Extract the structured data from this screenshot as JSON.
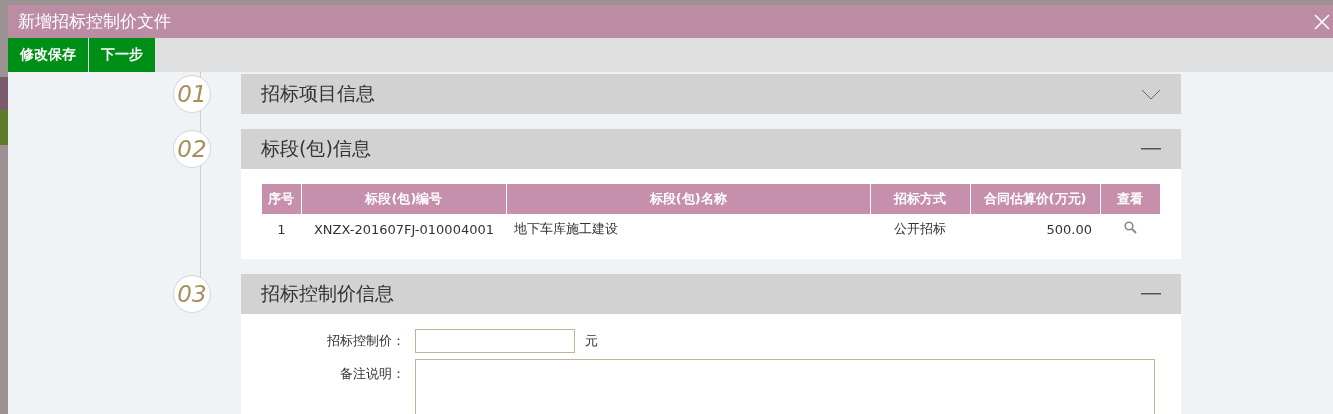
{
  "dialog": {
    "title": "新增招标控制价文件"
  },
  "toolbar": {
    "buttons": [
      "修改保存",
      "下一步"
    ]
  },
  "sections": [
    {
      "number": "01",
      "title": "招标项目信息",
      "expanded": false
    },
    {
      "number": "02",
      "title": "标段(包)信息",
      "expanded": true,
      "kind": "table"
    },
    {
      "number": "03",
      "title": "招标控制价信息",
      "expanded": true,
      "kind": "form"
    }
  ],
  "table": {
    "columns": [
      "序号",
      "标段(包)编号",
      "标段(包)名称",
      "招标方式",
      "合同估算价(万元)",
      "查看"
    ],
    "rows": [
      {
        "index": "1",
        "code": "XNZX-201607FJ-010004001",
        "name": "地下车库施工建设",
        "method": "公开招标",
        "price": "500.00"
      }
    ]
  },
  "form": {
    "price_label": "招标控制价：",
    "unit": "元",
    "note_label": "备注说明："
  }
}
